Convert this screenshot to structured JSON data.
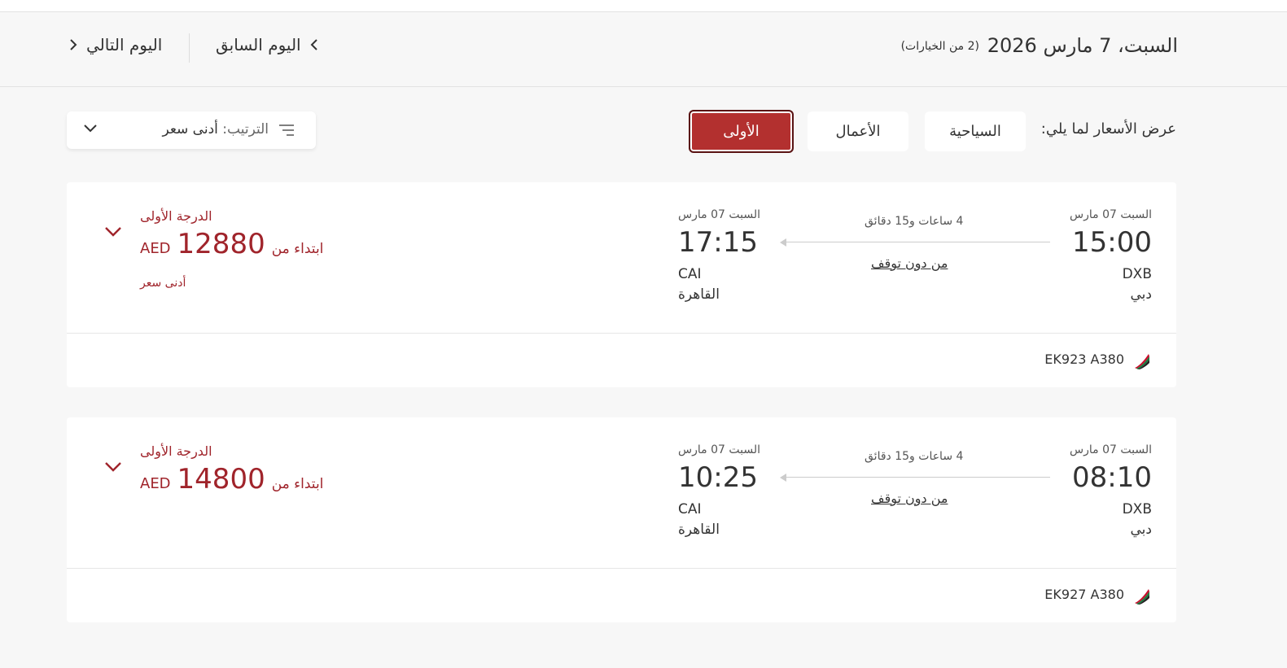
{
  "header": {
    "date_title": "السبت، 7 مارس 2026",
    "options_count": "(2 من الخيارات)",
    "prev_day": "اليوم السابق",
    "next_day": "اليوم التالي"
  },
  "fare_filter": {
    "label": "عرض الأسعار لما يلي:",
    "economy": "السياحية",
    "business": "الأعمال",
    "first": "الأولى",
    "selected": "الأولى"
  },
  "sort": {
    "label": "الترتيب:",
    "value": "أدنى سعر"
  },
  "colors": {
    "accent": "#a0242b",
    "selected_button": "#b3302f"
  },
  "flights": [
    {
      "dep_date": "السبت 07 مارس",
      "dep_time": "15:00",
      "dep_code": "DXB",
      "dep_city": "دبي",
      "arr_date": "السبت 07 مارس",
      "arr_time": "17:15",
      "arr_code": "CAI",
      "arr_city": "القاهرة",
      "duration": "4 ساعات و15 دقائق",
      "stops": "من دون توقف",
      "fare_class": "الدرجة الأولى",
      "price_from": "ابتداء من",
      "price_amount": "12880",
      "price_currency": "AED",
      "tag": "أدنى سعر",
      "flight_no": "EK923 A380"
    },
    {
      "dep_date": "السبت 07 مارس",
      "dep_time": "08:10",
      "dep_code": "DXB",
      "dep_city": "دبي",
      "arr_date": "السبت 07 مارس",
      "arr_time": "10:25",
      "arr_code": "CAI",
      "arr_city": "القاهرة",
      "duration": "4 ساعات و15 دقائق",
      "stops": "من دون توقف",
      "fare_class": "الدرجة الأولى",
      "price_from": "ابتداء من",
      "price_amount": "14800",
      "price_currency": "AED",
      "tag": "",
      "flight_no": "EK927 A380"
    }
  ]
}
